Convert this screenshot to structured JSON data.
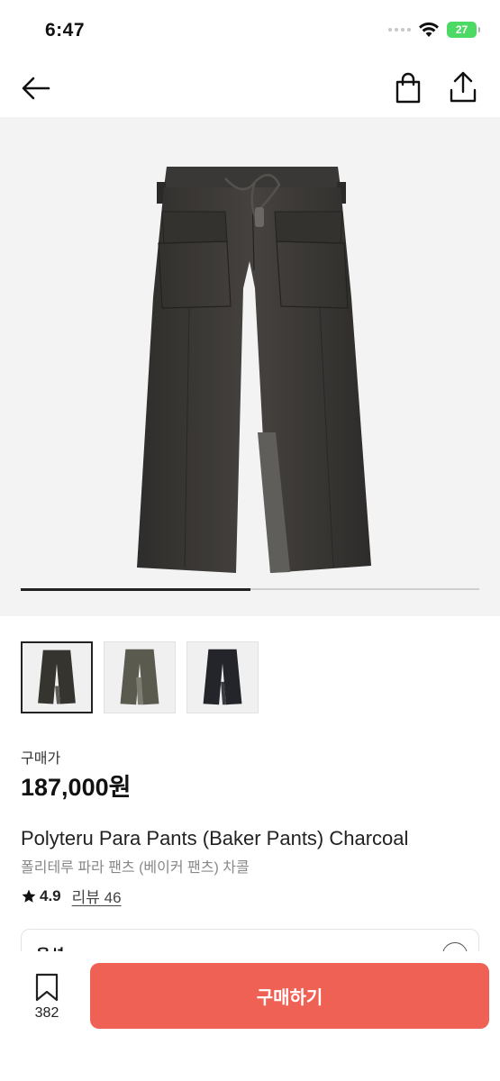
{
  "status_bar": {
    "time": "6:47",
    "battery": "27"
  },
  "nav": {
    "back_icon": "arrow-left-icon",
    "bag_icon": "shopping-bag-icon",
    "share_icon": "share-icon"
  },
  "gallery": {
    "progress": 0.5,
    "thumbnail_count": 3,
    "thumbnail_colors": [
      "charcoal",
      "khaki-grey",
      "navy"
    ]
  },
  "product": {
    "price_label": "구매가",
    "price": "187,000원",
    "title_en": "Polyteru Para Pants (Baker Pants) Charcoal",
    "title_ko": "폴리테루 파라 팬츠 (베이커 팬츠) 차콜",
    "rating": "4.9",
    "review_label": "리뷰 46"
  },
  "option": {
    "label": "옵션"
  },
  "bottom_bar": {
    "bookmark_count": "382",
    "buy_label": "구매하기"
  },
  "colors": {
    "accent": "#f06155",
    "pants_charcoal": "#3a3836"
  }
}
